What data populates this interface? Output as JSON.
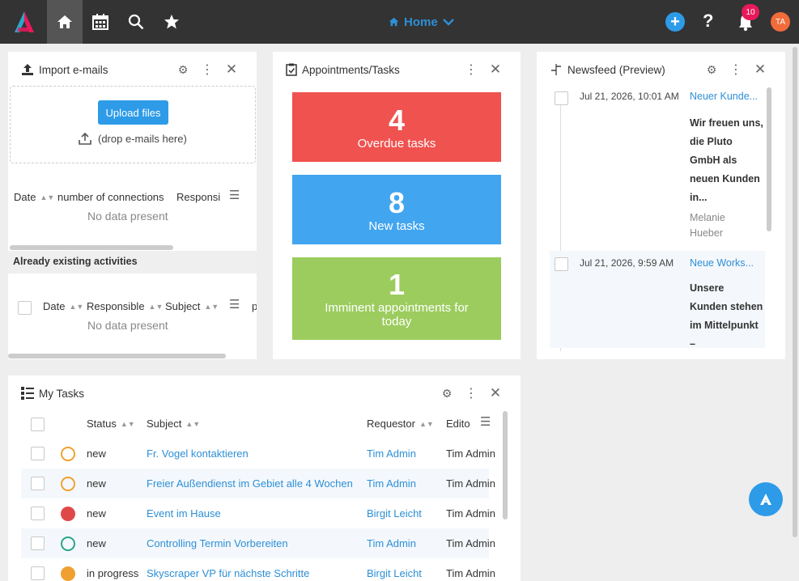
{
  "topbar": {
    "home_title": "Home",
    "notification_count": "10",
    "avatar_initials": "TA",
    "help_glyph": "?"
  },
  "import_panel": {
    "title": "Import e-mails",
    "upload_label": "Upload files",
    "drop_hint": "(drop e-mails here)",
    "columns": [
      "Date",
      "number of connections",
      "Responsi"
    ],
    "no_data": "No data present",
    "section_title": "Already existing activities",
    "columns2": [
      "Date",
      "Responsible",
      "Subject",
      "p"
    ],
    "no_data2": "No data present"
  },
  "appointments_panel": {
    "title": "Appointments/Tasks",
    "tiles": [
      {
        "count": "4",
        "label": "Overdue tasks",
        "color": "#f0524f"
      },
      {
        "count": "8",
        "label": "New tasks",
        "color": "#42a5f0"
      },
      {
        "count": "1",
        "label": "Imminent appointments for today",
        "color": "#9ccc5e"
      }
    ]
  },
  "newsfeed_panel": {
    "title": "Newsfeed (Preview)",
    "items": [
      {
        "date": "Jul 21, 2026, 10:01 AM",
        "link": "Neuer Kunde...",
        "body": "Wir freuen uns, die Pluto GmbH als neuen Kunden in...",
        "author": "Melanie Hueber"
      },
      {
        "date": "Jul 21, 2026, 9:59 AM",
        "link": "Neue Works...",
        "body": "Unsere Kunden stehen im Mittelpunkt –",
        "author": ""
      }
    ]
  },
  "tasks_panel": {
    "title": "My Tasks",
    "columns": {
      "status": "Status",
      "subject": "Subject",
      "requestor": "Requestor",
      "editor": "Edito"
    },
    "rows": [
      {
        "status": "new",
        "subject": "Fr. Vogel kontaktieren",
        "requestor": "Tim Admin",
        "editor": "Tim Admin",
        "dot": "open-orange"
      },
      {
        "status": "new",
        "subject": "Freier Außendienst im Gebiet alle 4 Wochen",
        "requestor": "Tim Admin",
        "editor": "Tim Admin",
        "dot": "open-orange"
      },
      {
        "status": "new",
        "subject": "Event im Hause",
        "requestor": "Birgit Leicht",
        "editor": "Tim Admin",
        "dot": "filled-red"
      },
      {
        "status": "new",
        "subject": "Controlling Termin Vorbereiten",
        "requestor": "Tim Admin",
        "editor": "Tim Admin",
        "dot": "open-green"
      },
      {
        "status": "in progress",
        "subject": "Skyscraper VP für nächste Schritte",
        "requestor": "Birgit Leicht",
        "editor": "Tim Admin",
        "dot": "filled-orange"
      }
    ]
  },
  "colors": {
    "topbar": "#333333",
    "accent": "#2d9be8",
    "link": "#2d8fd6",
    "badge": "#e8195a",
    "avatar": "#f26b3a"
  }
}
